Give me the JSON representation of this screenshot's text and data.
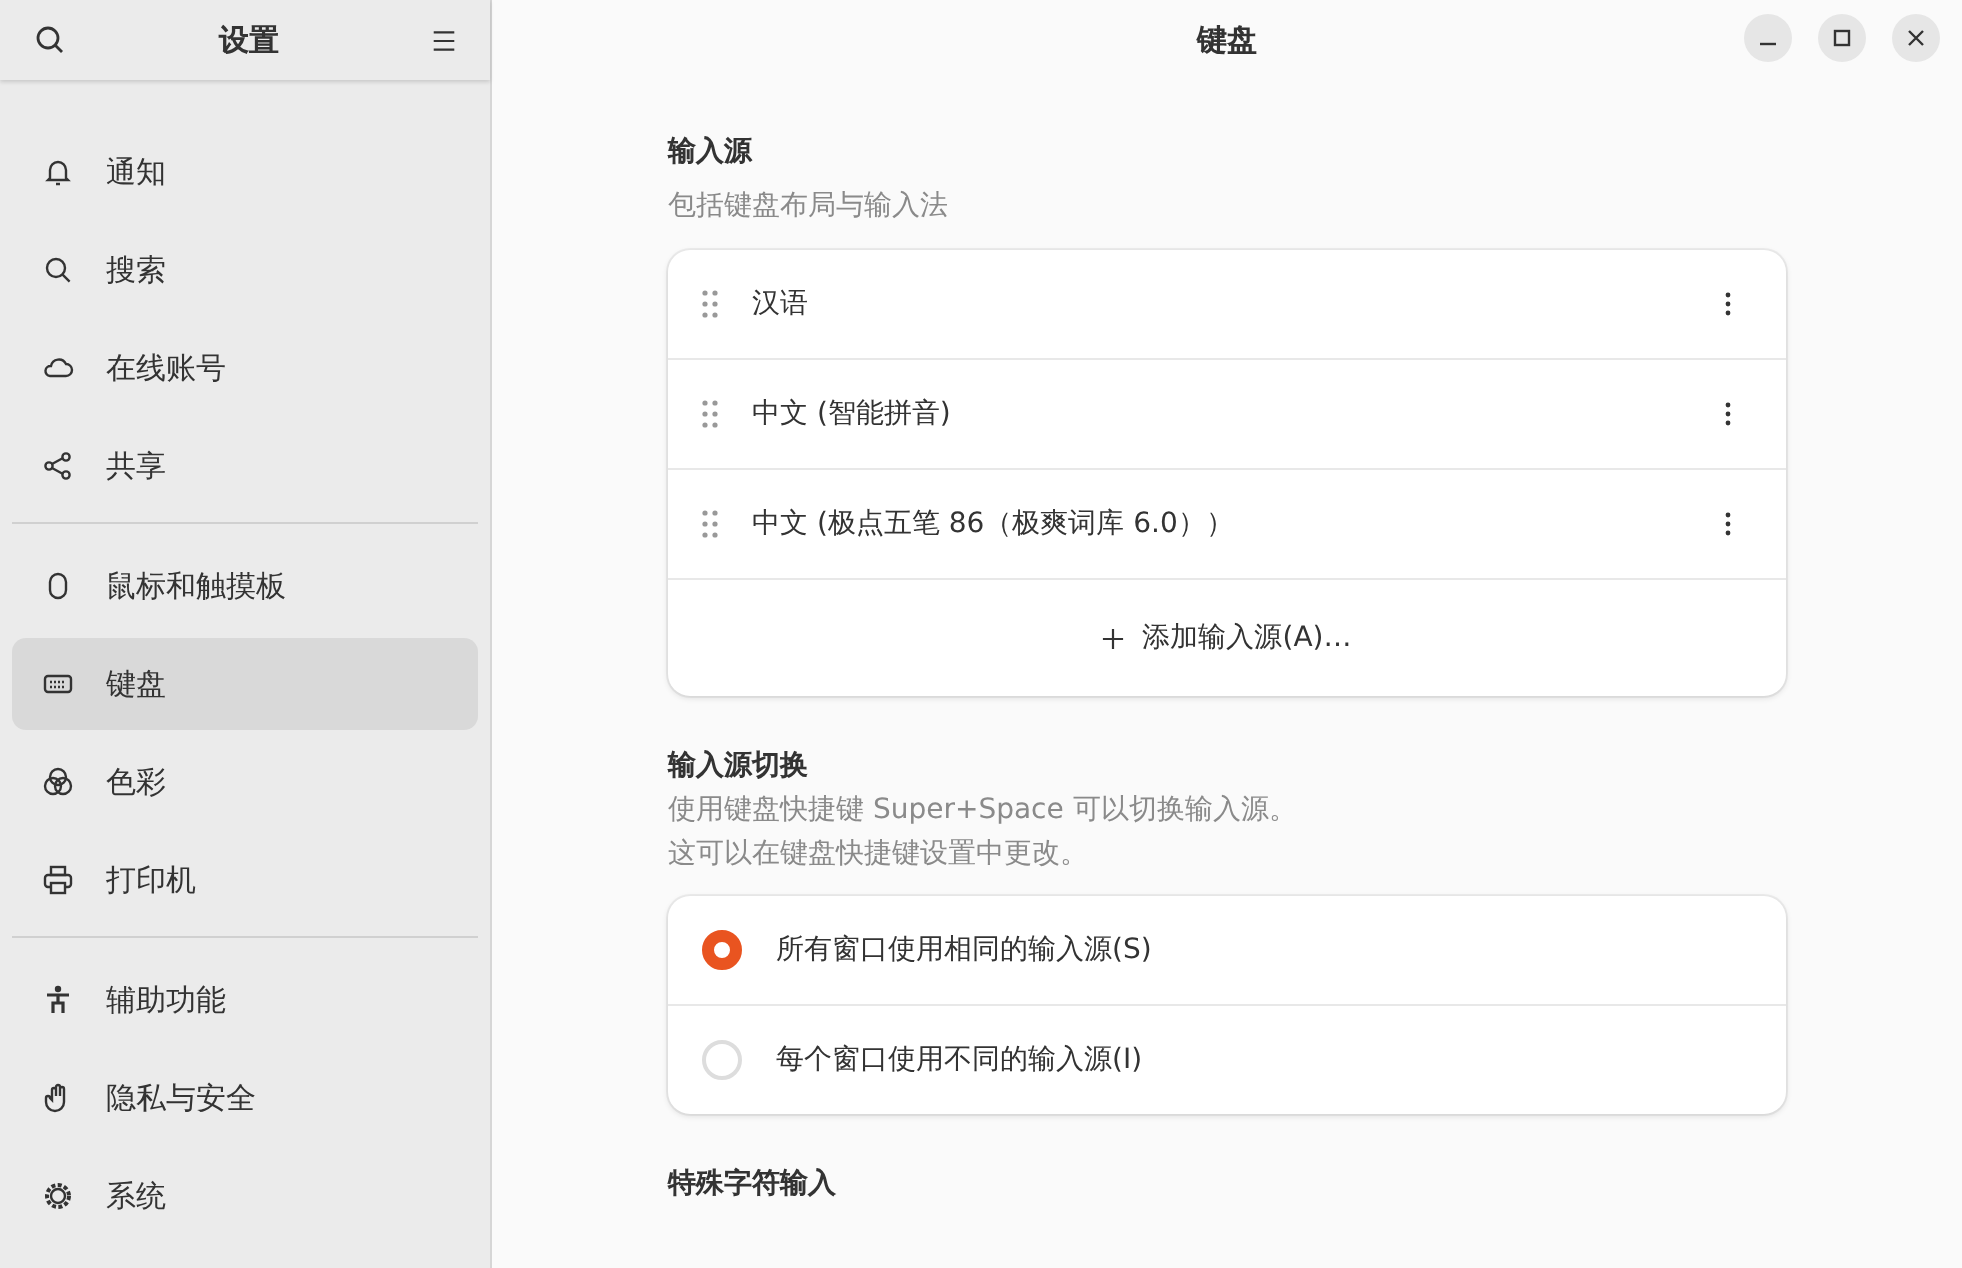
{
  "sidebar": {
    "title": "设置",
    "groups": [
      {
        "items": [
          {
            "label": "通知",
            "selected": false
          },
          {
            "label": "搜索",
            "selected": false
          },
          {
            "label": "在线账号",
            "selected": false
          },
          {
            "label": "共享",
            "selected": false
          }
        ]
      },
      {
        "items": [
          {
            "label": "鼠标和触摸板",
            "selected": false
          },
          {
            "label": "键盘",
            "selected": true
          },
          {
            "label": "色彩",
            "selected": false
          },
          {
            "label": "打印机",
            "selected": false
          }
        ]
      },
      {
        "items": [
          {
            "label": "辅助功能",
            "selected": false
          },
          {
            "label": "隐私与安全",
            "selected": false
          },
          {
            "label": "系统",
            "selected": false
          }
        ]
      }
    ]
  },
  "window": {
    "title": "键盘"
  },
  "input_sources": {
    "heading": "输入源",
    "description": "包括键盘布局与输入法",
    "rows": [
      {
        "label": "汉语"
      },
      {
        "label": "中文 (智能拼音)"
      },
      {
        "label": "中文 (极点五笔 86（极爽词库 6.0））"
      }
    ],
    "add_button": "添加输入源(A)…"
  },
  "switching": {
    "heading": "输入源切换",
    "description": [
      "使用键盘快捷键 Super+Space 可以切换输入源。",
      "这可以在键盘快捷键设置中更改。"
    ],
    "options": [
      {
        "label": "所有窗口使用相同的输入源(S)",
        "selected": true
      },
      {
        "label": "每个窗口使用不同的输入源(I)",
        "selected": false
      }
    ]
  },
  "special_chars": {
    "heading": "特殊字符输入"
  }
}
